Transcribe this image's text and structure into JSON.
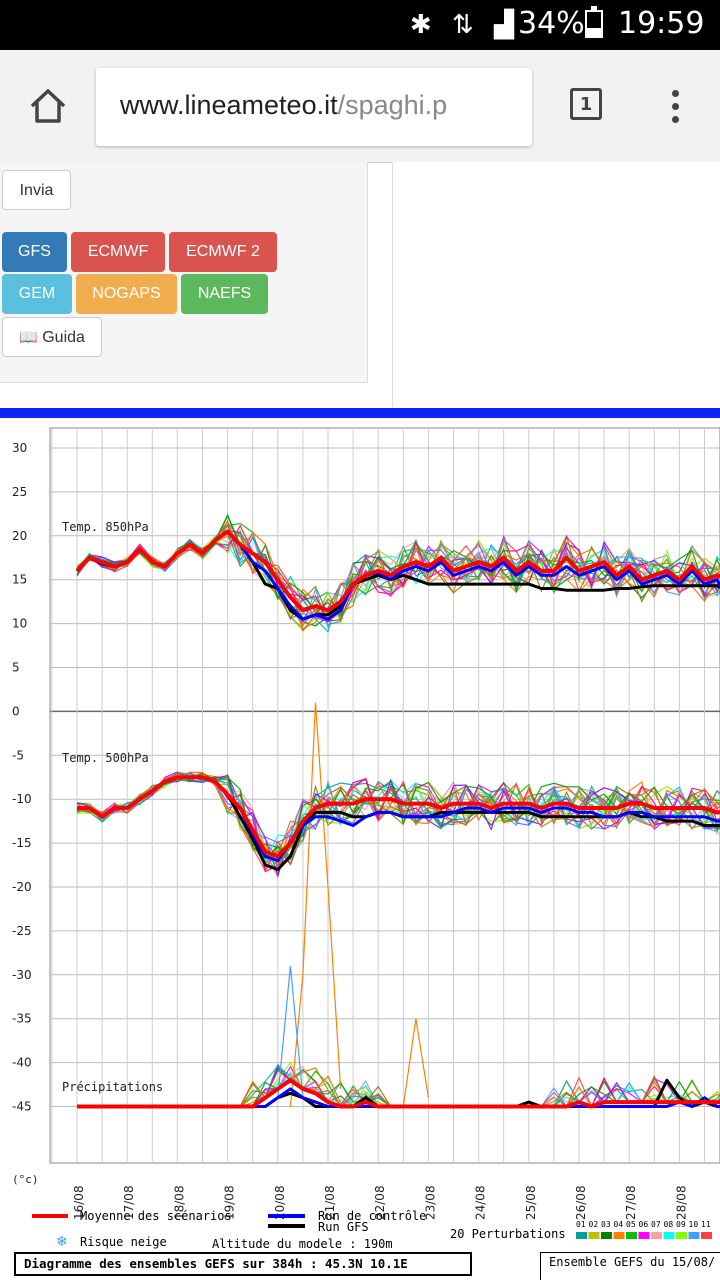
{
  "status_bar": {
    "battery": "34%",
    "time": "19:59",
    "battery_level": 0.34
  },
  "browser": {
    "url_domain": "www.lineameteo.it",
    "url_path": "/spaghi.p",
    "tab_count": "1"
  },
  "controls": {
    "submit_label": "Invia",
    "models": [
      {
        "label": "GFS",
        "color": "#337ab7"
      },
      {
        "label": "ECMWF",
        "color": "#d9534f"
      },
      {
        "label": "ECMWF 2",
        "color": "#d9534f"
      },
      {
        "label": "GEM",
        "color": "#5bc0de"
      },
      {
        "label": "NOGAPS",
        "color": "#f0ad4e"
      },
      {
        "label": "NAEFS",
        "color": "#5cb85c"
      }
    ],
    "guide_label": "Guida"
  },
  "chart_data": {
    "type": "line",
    "yticks": [
      "30",
      "25",
      "20",
      "15",
      "10",
      "5",
      "0",
      "-5",
      "-10",
      "-15",
      "-20",
      "-25",
      "-30",
      "-35",
      "-40",
      "-45"
    ],
    "yunit": "(°c)",
    "xticks": [
      "16/08",
      "17/08",
      "18/08",
      "19/08",
      "20/08",
      "21/08",
      "22/08",
      "23/08",
      "24/08",
      "25/08",
      "26/08",
      "27/08",
      "28/08"
    ],
    "panel_labels": [
      "Temp. 850hPa",
      "Temp. 500hPa",
      "Précipitations"
    ],
    "x": [
      0,
      6,
      12,
      18,
      24,
      30,
      36,
      42,
      48,
      54,
      60,
      66,
      72,
      78,
      84,
      90,
      96,
      102,
      108,
      114,
      120,
      126,
      132,
      138,
      144,
      150,
      156,
      162,
      168,
      174,
      180,
      186,
      192,
      198,
      204,
      210,
      216,
      222,
      228,
      234,
      240,
      246,
      252,
      258,
      264,
      270,
      276,
      282,
      288,
      294,
      300,
      306,
      312,
      318
    ],
    "series": [
      {
        "name": "Moyenne des scénarios",
        "color": "#ff0000",
        "width": 4,
        "t850": [
          16,
          17.5,
          17,
          16.5,
          17,
          18.5,
          17,
          16.5,
          18,
          19,
          18,
          19.5,
          20.5,
          19,
          18,
          17,
          15,
          13,
          11.5,
          12,
          11.5,
          12.5,
          14.5,
          15.5,
          16,
          15.5,
          16.5,
          17,
          16.5,
          17.5,
          16,
          16.5,
          17,
          16.5,
          17.5,
          16,
          17,
          16,
          16,
          17.5,
          16,
          16.5,
          17,
          15.5,
          16.5,
          15,
          15.5,
          16,
          15,
          16.5,
          15,
          15.5,
          15,
          15
        ],
        "t500": [
          -11,
          -11,
          -12,
          -11,
          -11,
          -10,
          -9,
          -8,
          -7.5,
          -7.5,
          -7.5,
          -8,
          -9.5,
          -11,
          -13.5,
          -16,
          -16.5,
          -15,
          -12.5,
          -11,
          -10.5,
          -10.5,
          -10.5,
          -10,
          -10,
          -10,
          -10.5,
          -10.5,
          -10.5,
          -11,
          -10.5,
          -10.5,
          -10.5,
          -11,
          -10.5,
          -10.5,
          -10.5,
          -11,
          -10.5,
          -10.5,
          -11,
          -11,
          -11,
          -11,
          -10.5,
          -10.5,
          -11,
          -11,
          -11,
          -11,
          -11,
          -11.5,
          -11.5,
          -11.5
        ],
        "precip": [
          -45,
          -45,
          -45,
          -45,
          -45,
          -45,
          -45,
          -45,
          -45,
          -45,
          -45,
          -45,
          -45,
          -45,
          -45,
          -44,
          -43,
          -42,
          -43,
          -43.5,
          -44.5,
          -45,
          -45,
          -44.5,
          -45,
          -45,
          -45,
          -45,
          -45,
          -45,
          -45,
          -45,
          -45,
          -45,
          -45,
          -45,
          -45,
          -45,
          -45,
          -45,
          -44.5,
          -45,
          -44.5,
          -44.5,
          -44.5,
          -44.5,
          -44.5,
          -44.5,
          -44.5,
          -44.5,
          -44.5,
          -44.5,
          -44.5,
          -44.5
        ]
      },
      {
        "name": "Run de contrôle",
        "color": "#0000ff",
        "width": 3,
        "t850": [
          16,
          17.5,
          16.8,
          16.5,
          17,
          18.5,
          17,
          16.5,
          18,
          19,
          18,
          19.5,
          20.5,
          19,
          17,
          16,
          14,
          12,
          10.5,
          11,
          10.5,
          11.5,
          14.5,
          15.5,
          15.8,
          15,
          16,
          16.5,
          16,
          17,
          15.5,
          16,
          16.5,
          16,
          17,
          15.5,
          16.5,
          15.5,
          15.5,
          16.5,
          15.5,
          16,
          16.5,
          15,
          16,
          14.5,
          15,
          15.5,
          14.5,
          16,
          14.5,
          15,
          12,
          13
        ],
        "t500": [
          -11,
          -11,
          -12,
          -11,
          -11,
          -10,
          -9,
          -8,
          -7.5,
          -7.5,
          -7.5,
          -8,
          -9.5,
          -11,
          -14,
          -16.5,
          -17,
          -15,
          -13,
          -12,
          -12,
          -12.5,
          -13,
          -12,
          -11.5,
          -11.5,
          -12,
          -12,
          -12,
          -12,
          -11.5,
          -11,
          -11,
          -11.5,
          -11,
          -11,
          -11,
          -11.5,
          -11,
          -11,
          -11.5,
          -11.5,
          -12,
          -12,
          -11.5,
          -11.5,
          -12,
          -12,
          -12,
          -12,
          -12,
          -12.5,
          -12.5,
          -12.5
        ],
        "precip": [
          -45,
          -45,
          -45,
          -45,
          -45,
          -45,
          -45,
          -45,
          -45,
          -45,
          -45,
          -45,
          -45,
          -45,
          -45,
          -45,
          -44,
          -43,
          -44,
          -44.5,
          -45,
          -45,
          -45,
          -45,
          -45,
          -45,
          -45,
          -45,
          -45,
          -45,
          -45,
          -45,
          -45,
          -45,
          -45,
          -45,
          -45,
          -45,
          -45,
          -45,
          -45,
          -45,
          -45,
          -45,
          -45,
          -45,
          -45,
          -45,
          -44.5,
          -45,
          -44,
          -45,
          -45,
          -45
        ]
      },
      {
        "name": "Run GFS",
        "color": "#000000",
        "width": 3,
        "t850": [
          16,
          17.5,
          16.8,
          16.5,
          17,
          18.5,
          17,
          16.5,
          18,
          19,
          18,
          19.5,
          20.5,
          19,
          17,
          14.5,
          14,
          11.5,
          10.5,
          11,
          11,
          12,
          14.5,
          15,
          15.5,
          15,
          15.5,
          15,
          14.5,
          14.5,
          14.5,
          14.5,
          14.5,
          14.5,
          14.5,
          14.5,
          14.5,
          14,
          14,
          13.8,
          13.8,
          13.8,
          13.8,
          14,
          14,
          14.2,
          14.3,
          14.3,
          14.3,
          14.3,
          14.3,
          14.3,
          13.5,
          13.5
        ],
        "t500": [
          -11,
          -11,
          -12,
          -11,
          -11,
          -10,
          -9,
          -8,
          -7.5,
          -7.5,
          -7.5,
          -8,
          -9.5,
          -12,
          -14.5,
          -17.5,
          -18,
          -16.5,
          -13,
          -11.5,
          -11.5,
          -11.5,
          -12,
          -12,
          -11.5,
          -11.5,
          -12,
          -12,
          -12,
          -11.5,
          -11.5,
          -11.5,
          -11.5,
          -11.5,
          -11.5,
          -11.5,
          -11.5,
          -12,
          -12,
          -12,
          -12,
          -12,
          -12,
          -12,
          -11.5,
          -12,
          -12,
          -12.5,
          -12.5,
          -12.5,
          -13,
          -13,
          -13,
          -13.5
        ],
        "precip": [
          -45,
          -45,
          -45,
          -45,
          -45,
          -45,
          -45,
          -45,
          -45,
          -45,
          -45,
          -45,
          -45,
          -45,
          -45,
          -45,
          -44,
          -43.5,
          -44,
          -45,
          -45,
          -45,
          -45,
          -44,
          -45,
          -45,
          -45,
          -45,
          -45,
          -45,
          -45,
          -45,
          -45,
          -45,
          -45,
          -45,
          -44.5,
          -45,
          -45,
          -45,
          -45,
          -45,
          -45,
          -45,
          -45,
          -45,
          -45,
          -42,
          -44,
          -45,
          -44.5,
          -45,
          -45,
          -45
        ]
      }
    ],
    "perturbations": {
      "count_label": "20 Perturbations",
      "numbers": [
        "01",
        "02",
        "03",
        "04",
        "05",
        "06",
        "07",
        "08",
        "09",
        "10",
        "11"
      ],
      "colors": [
        "#00a0a0",
        "#c0c000",
        "#008000",
        "#ff8000",
        "#00c000",
        "#ff00ff",
        "#ffa0a0",
        "#00ffff",
        "#80ff00",
        "#40a0ff",
        "#ff4040",
        "#a0a0a0",
        "#808000",
        "#a000ff",
        "#00c080",
        "#ff0080",
        "#6060ff",
        "#c08000",
        "#00a000",
        "#ff6000"
      ]
    },
    "legend_extra": {
      "snow": "Risque neige",
      "altitude": "Altitude du modele : 190m"
    }
  },
  "caption": "Diagramme des ensembles GEFS sur 384h : 45.3N 10.1E",
  "caption_right": "Ensemble GEFS du 15/08/"
}
